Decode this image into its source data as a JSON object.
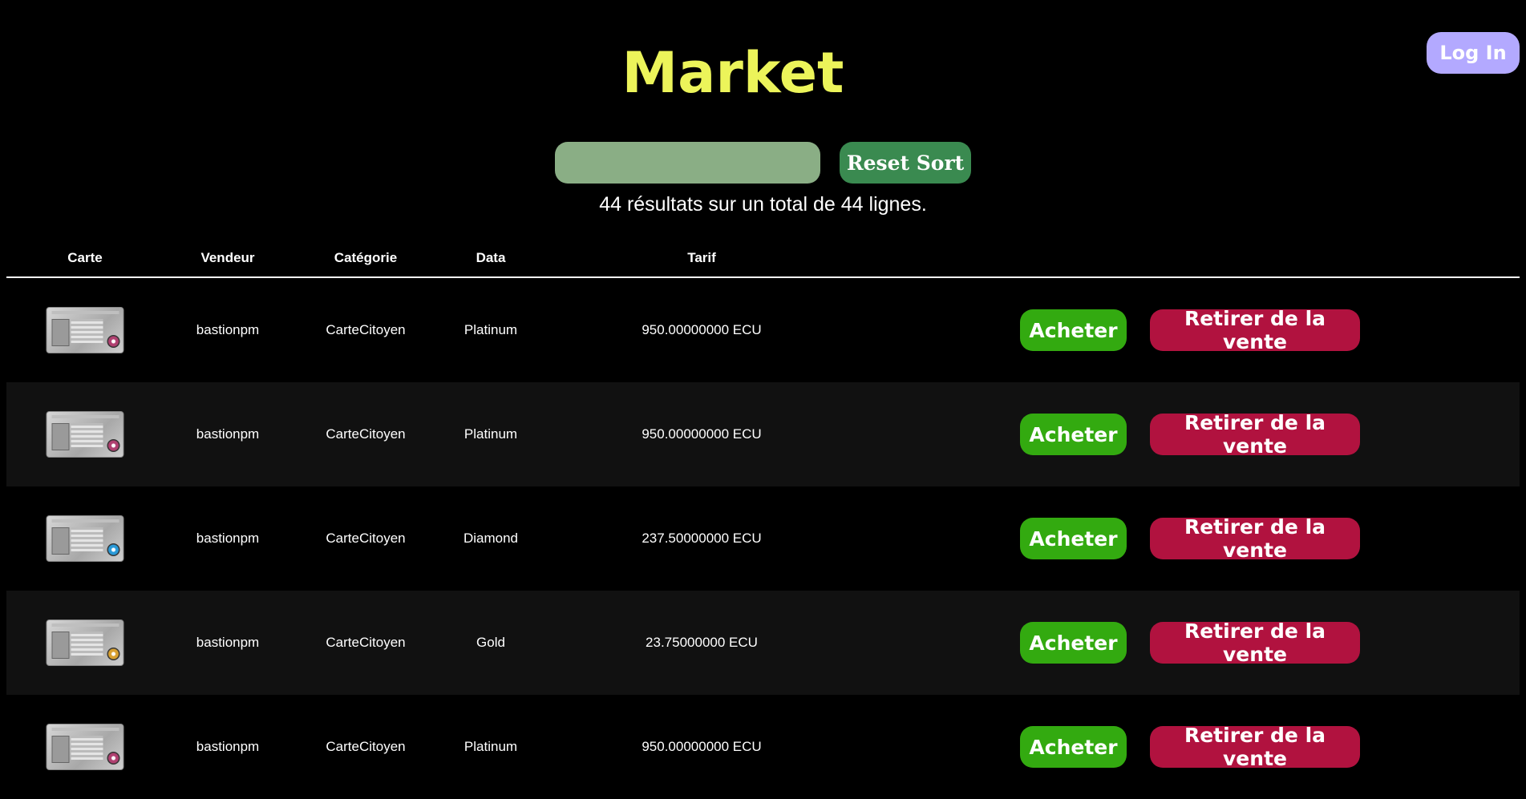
{
  "header": {
    "title": "Market",
    "login_label": "Log In"
  },
  "controls": {
    "search_value": "",
    "search_placeholder": "",
    "reset_label": "Reset Sort",
    "results_text": "44 résultats sur un total de 44 lignes."
  },
  "table": {
    "columns": [
      "Carte",
      "Vendeur",
      "Catégorie",
      "Data",
      "Tarif"
    ],
    "buy_label": "Acheter",
    "remove_label": "Retirer de la vente",
    "rows": [
      {
        "card_icon": "citizen-card-image",
        "emblem_color": "#b04070",
        "seller": "bastionpm",
        "category": "CarteCitoyen",
        "data": "Platinum",
        "price": "950.00000000 ECU"
      },
      {
        "card_icon": "citizen-card-image",
        "emblem_color": "#b04070",
        "seller": "bastionpm",
        "category": "CarteCitoyen",
        "data": "Platinum",
        "price": "950.00000000 ECU"
      },
      {
        "card_icon": "citizen-card-image",
        "emblem_color": "#2a9ad8",
        "seller": "bastionpm",
        "category": "CarteCitoyen",
        "data": "Diamond",
        "price": "237.50000000 ECU"
      },
      {
        "card_icon": "citizen-card-image",
        "emblem_color": "#d8a030",
        "seller": "bastionpm",
        "category": "CarteCitoyen",
        "data": "Gold",
        "price": "23.75000000 ECU"
      },
      {
        "card_icon": "citizen-card-image",
        "emblem_color": "#b04070",
        "seller": "bastionpm",
        "category": "CarteCitoyen",
        "data": "Platinum",
        "price": "950.00000000 ECU"
      }
    ]
  },
  "colors": {
    "title": "#ecf45a",
    "login": "#b3a9ff",
    "search": "#8aae85",
    "reset": "#3a8a50",
    "buy": "#33aa10",
    "remove": "#b1123f"
  }
}
